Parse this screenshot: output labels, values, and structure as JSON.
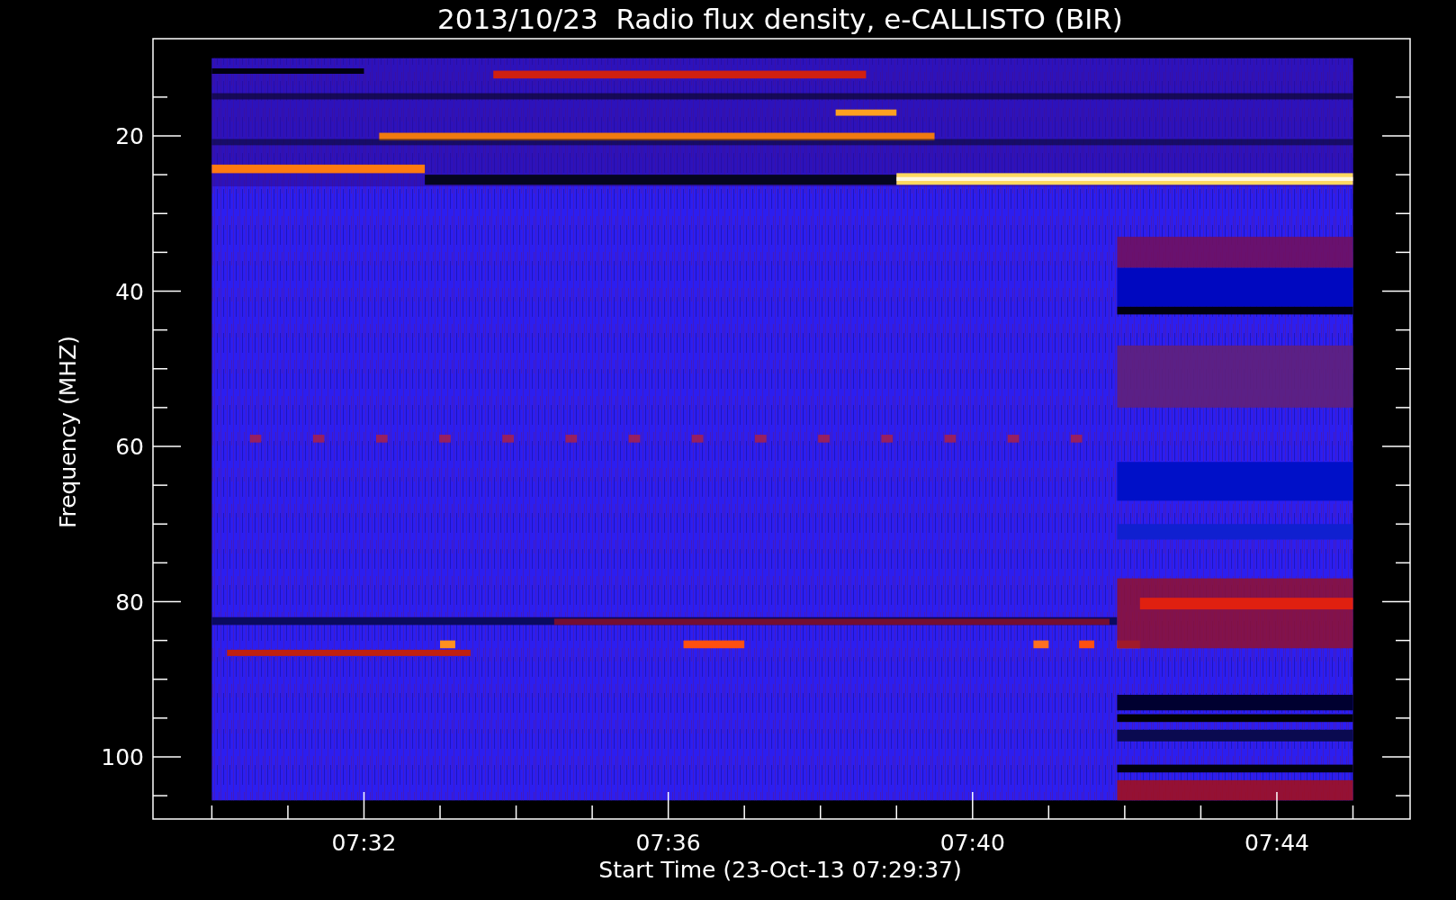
{
  "plot": {
    "title": "2013/10/23  Radio flux density, e-CALLISTO (BIR)",
    "xlabel": "Start Time (23-Oct-13 07:29:37)",
    "ylabel": "Frequency (MHZ)",
    "x_tick_labels": [
      "07:32",
      "07:36",
      "07:40",
      "07:44"
    ],
    "y_tick_labels": [
      "20",
      "40",
      "60",
      "80",
      "100"
    ]
  }
}
